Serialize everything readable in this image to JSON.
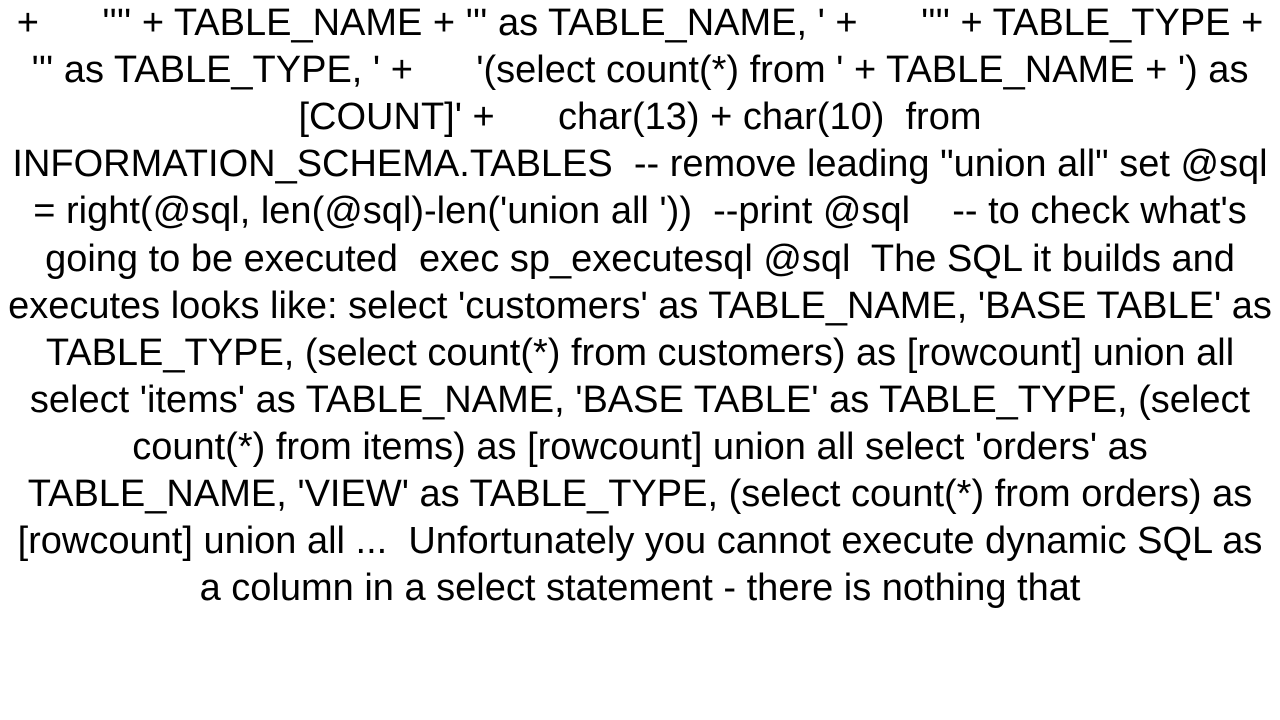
{
  "body": {
    "text": "+      '''' + TABLE_NAME + ''' as TABLE_NAME, ' +      '''' + TABLE_TYPE + ''' as TABLE_TYPE, ' +      '(select count(*) from ' + TABLE_NAME + ') as [COUNT]' +      char(13) + char(10)  from INFORMATION_SCHEMA.TABLES  -- remove leading \"union all\" set @sql = right(@sql, len(@sql)-len('union all '))  --print @sql    -- to check what's going to be executed  exec sp_executesql @sql  The SQL it builds and executes looks like: select 'customers' as TABLE_NAME, 'BASE TABLE' as TABLE_TYPE, (select count(*) from customers) as [rowcount] union all select 'items' as TABLE_NAME, 'BASE TABLE' as TABLE_TYPE, (select count(*) from items) as [rowcount] union all select 'orders' as TABLE_NAME, 'VIEW' as TABLE_TYPE, (select count(*) from orders) as [rowcount] union all ...  Unfortunately you cannot execute dynamic SQL as a column in a select statement - there is nothing that"
  }
}
